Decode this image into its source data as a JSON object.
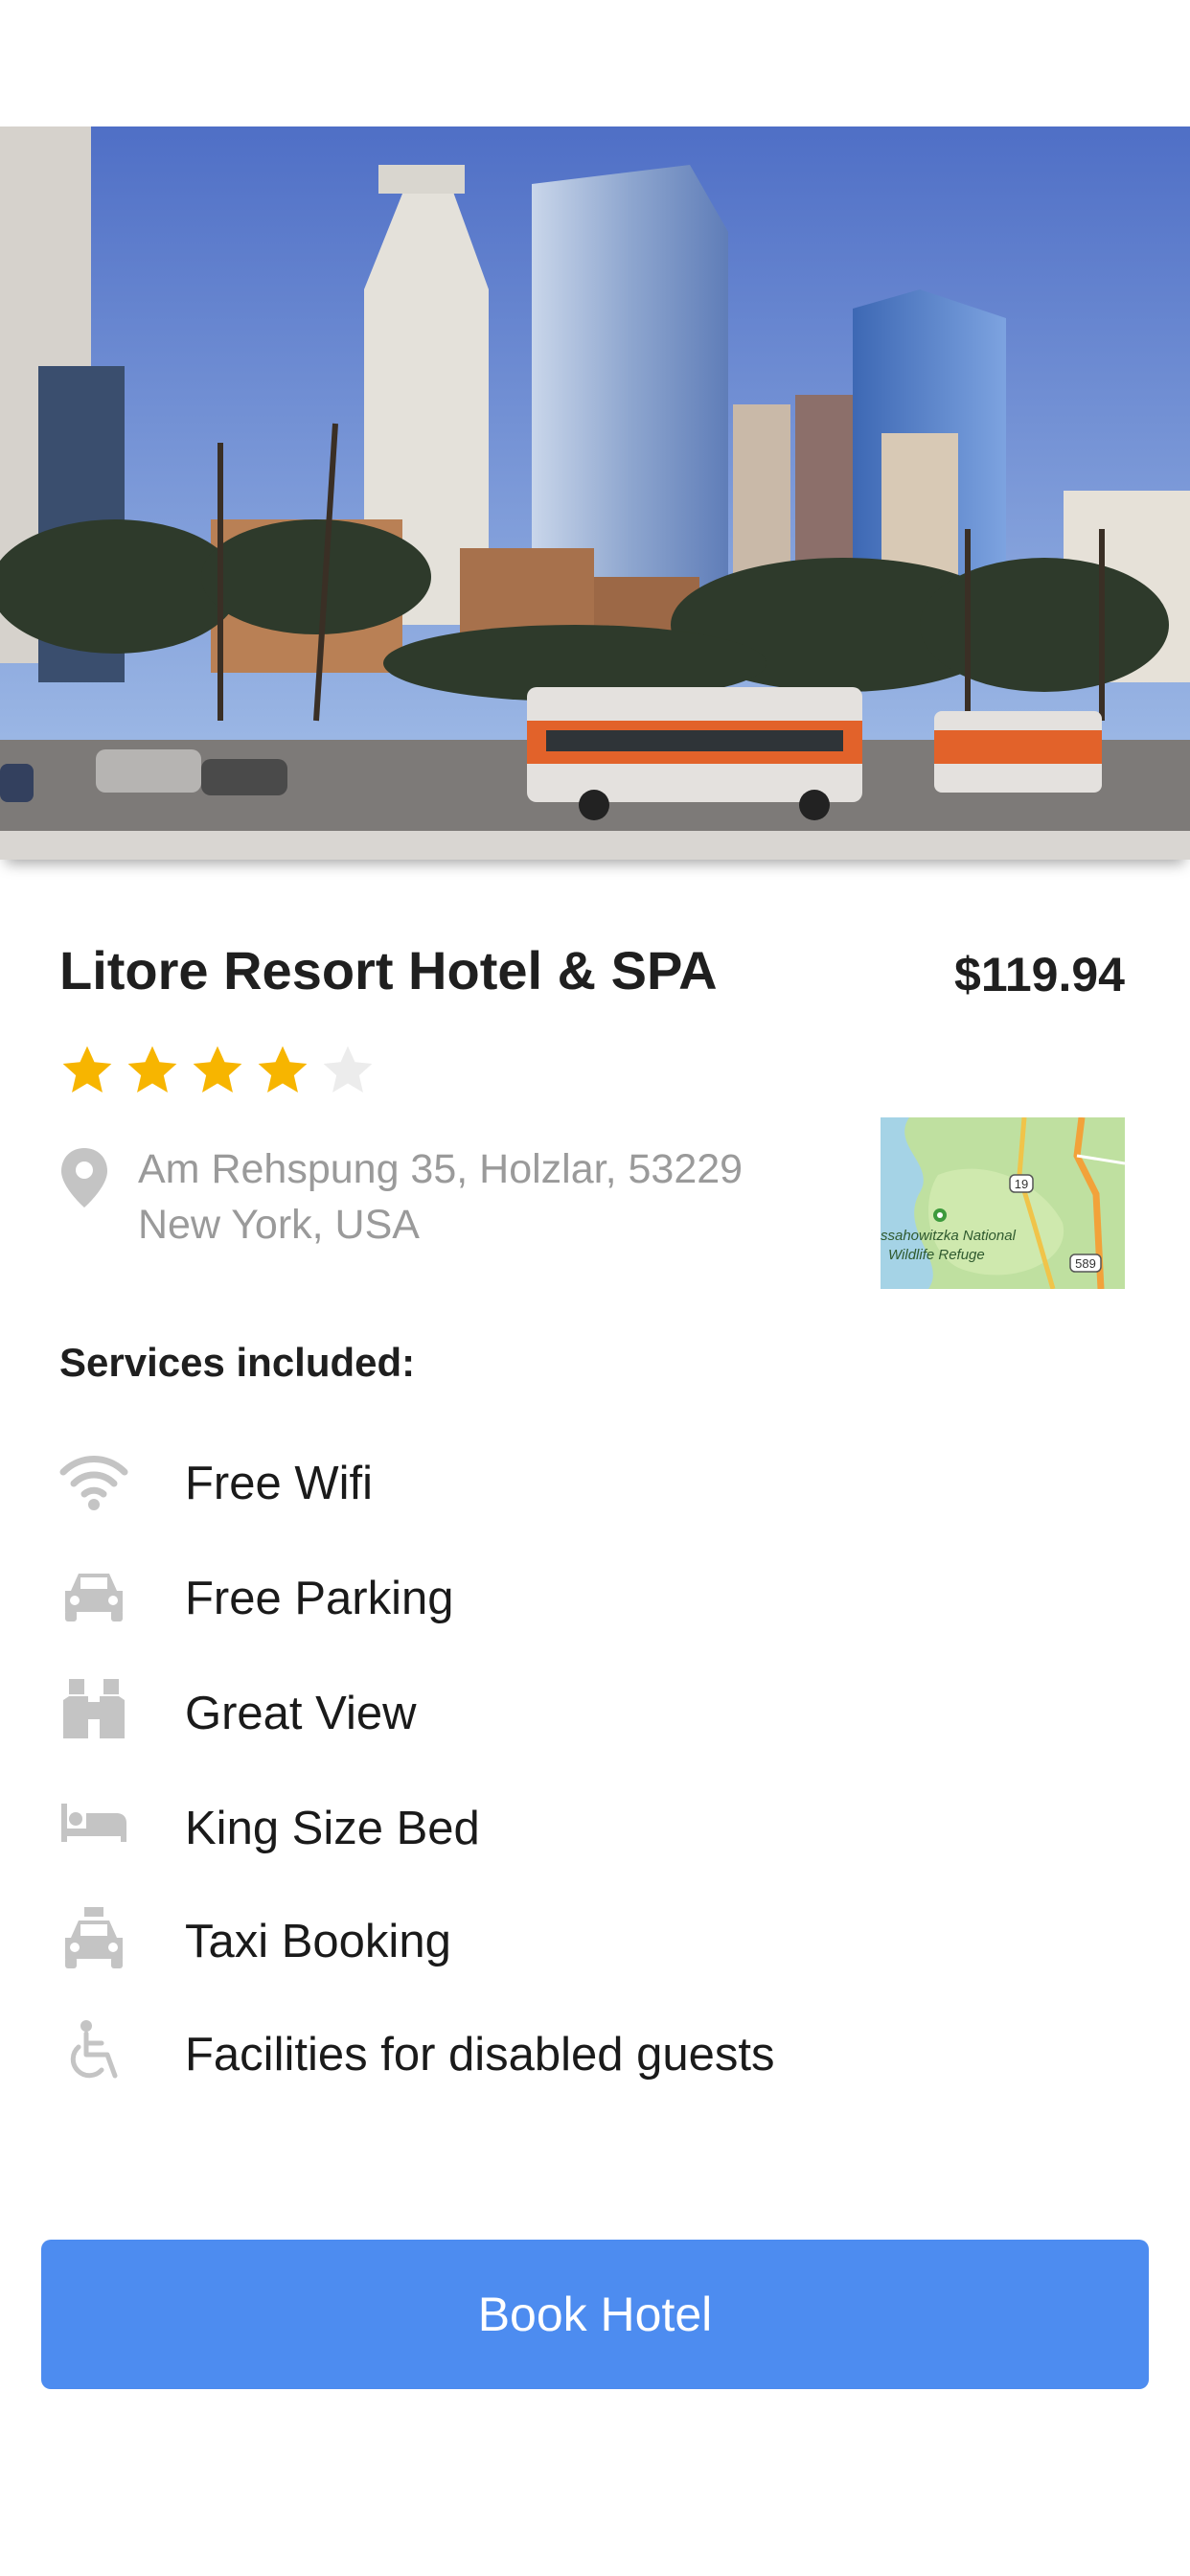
{
  "hotel": {
    "name": "Litore Resort Hotel & SPA",
    "price": "$119.94",
    "rating": 4,
    "max_rating": 5,
    "address_line1": "Am Rehspung 35, Holzlar, 53229",
    "address_line2": "New York, USA"
  },
  "map": {
    "labels": [
      "ssahowitzka National",
      "Wildlife Refuge"
    ],
    "shields": [
      "19",
      "589"
    ]
  },
  "services": {
    "title": "Services included:",
    "items": [
      {
        "label": "Free Wifi",
        "icon": "wifi-icon"
      },
      {
        "label": "Free Parking",
        "icon": "car-icon"
      },
      {
        "label": "Great View",
        "icon": "binoculars-icon"
      },
      {
        "label": "King Size Bed",
        "icon": "bed-icon"
      },
      {
        "label": "Taxi Booking",
        "icon": "taxi-icon"
      },
      {
        "label": "Facilities for disabled guests",
        "icon": "wheelchair-icon"
      }
    ]
  },
  "actions": {
    "book_label": "Book Hotel"
  },
  "colors": {
    "accent": "#4d8cf0",
    "star_filled": "#f7b500",
    "star_empty": "#ececec",
    "icon_gray": "#c4c4c4",
    "secondary_text": "#9a9a9a"
  }
}
